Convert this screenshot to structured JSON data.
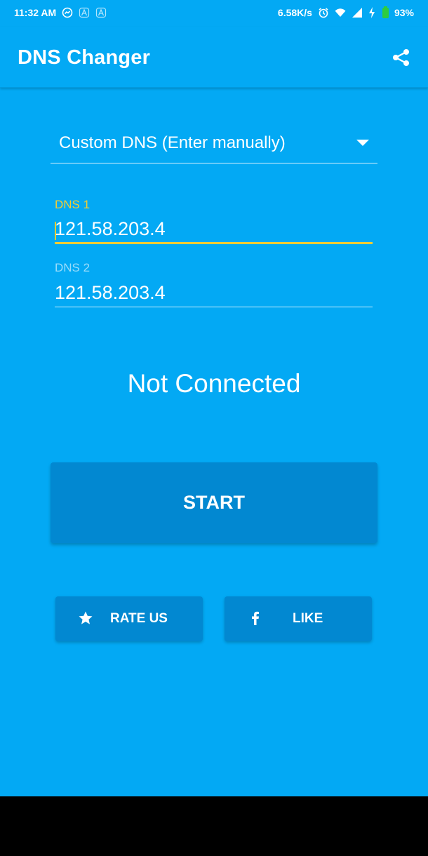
{
  "status_bar": {
    "time": "11:32 AM",
    "net_speed": "6.58K/s",
    "battery_percent": "93%",
    "icons_left": [
      "messenger-icon",
      "notification-a-icon",
      "notification-a-icon"
    ],
    "icons_right": [
      "alarm-icon",
      "wifi-icon",
      "signal-icon",
      "charging-icon",
      "battery-icon"
    ],
    "battery_level": 0.93
  },
  "app_bar": {
    "title": "DNS Changer",
    "share_icon": "share-icon"
  },
  "dns_select": {
    "selected": "Custom DNS (Enter manually)"
  },
  "dns1": {
    "label": "DNS 1",
    "value": "121.58.203.4"
  },
  "dns2": {
    "label": "DNS 2",
    "value": "121.58.203.4"
  },
  "status": {
    "text": "Not Connected"
  },
  "buttons": {
    "start": "START",
    "rate_us": "RATE US",
    "like": "LIKE"
  },
  "colors": {
    "background": "#03a9f4",
    "button": "#0288d1",
    "focus_accent": "#f2cd34",
    "battery": "#2ecc40"
  }
}
